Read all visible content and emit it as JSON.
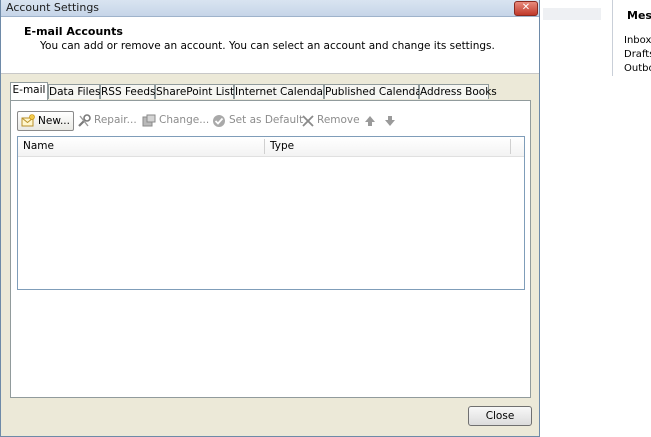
{
  "dialog": {
    "title": "Account Settings",
    "close_glyph": "✕",
    "header_title": "E-mail Accounts",
    "header_description": "You can add or remove an account. You can select an account and change its settings."
  },
  "tabs": [
    {
      "label": "E-mail",
      "active": true
    },
    {
      "label": "Data Files",
      "active": false
    },
    {
      "label": "RSS Feeds",
      "active": false
    },
    {
      "label": "SharePoint Lists",
      "active": false
    },
    {
      "label": "Internet Calendars",
      "active": false
    },
    {
      "label": "Published Calendars",
      "active": false
    },
    {
      "label": "Address Books",
      "active": false
    }
  ],
  "toolbar": {
    "new_label": "New...",
    "repair_label": "Repair...",
    "change_label": "Change...",
    "set_default_label": "Set as Default",
    "remove_label": "Remove",
    "move_up_icon": "arrow-up-icon",
    "move_down_icon": "arrow-down-icon"
  },
  "list": {
    "columns": [
      "Name",
      "Type"
    ],
    "rows": []
  },
  "footer": {
    "close_label": "Close"
  },
  "background": {
    "title": "Mess",
    "folders": [
      "Inbox",
      "Drafts",
      "Outbo"
    ]
  }
}
